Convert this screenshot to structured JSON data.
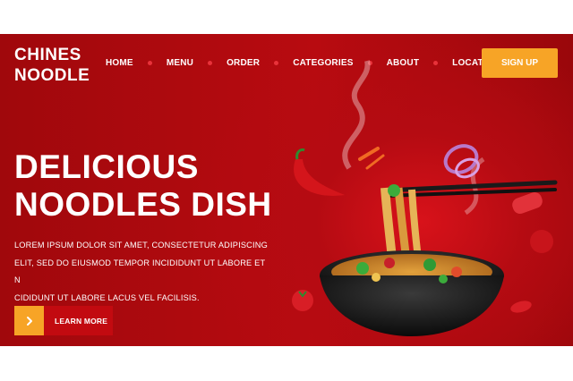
{
  "brand": {
    "line1": "CHINES",
    "line2": "NOODLE"
  },
  "nav": {
    "items": [
      "HOME",
      "MENU",
      "ORDER",
      "CATEGORIES",
      "ABOUT",
      "LOCATION"
    ]
  },
  "signup_label": "SIGN UP",
  "hero": {
    "title_line1": "DELICIOUS",
    "title_line2": "NOODLES DISH",
    "body_line1": "LOREM IPSUM DOLOR SIT AMET, CONSECTETUR ADIPISCING",
    "body_line2": "ELIT, SED DO EIUSMOD TEMPOR INCIDIDUNT UT LABORE ET N",
    "body_line3": "CIDIDUNT UT LABORE LACUS VEL FACILISIS.",
    "cta_label": "LEARN MORE"
  },
  "icons": {
    "cta_arrow": "chevron-right-icon",
    "nav_separator": "dot-icon"
  },
  "colors": {
    "hero_red": "#b80b10",
    "accent_orange": "#f7a426",
    "text": "#ffffff"
  }
}
